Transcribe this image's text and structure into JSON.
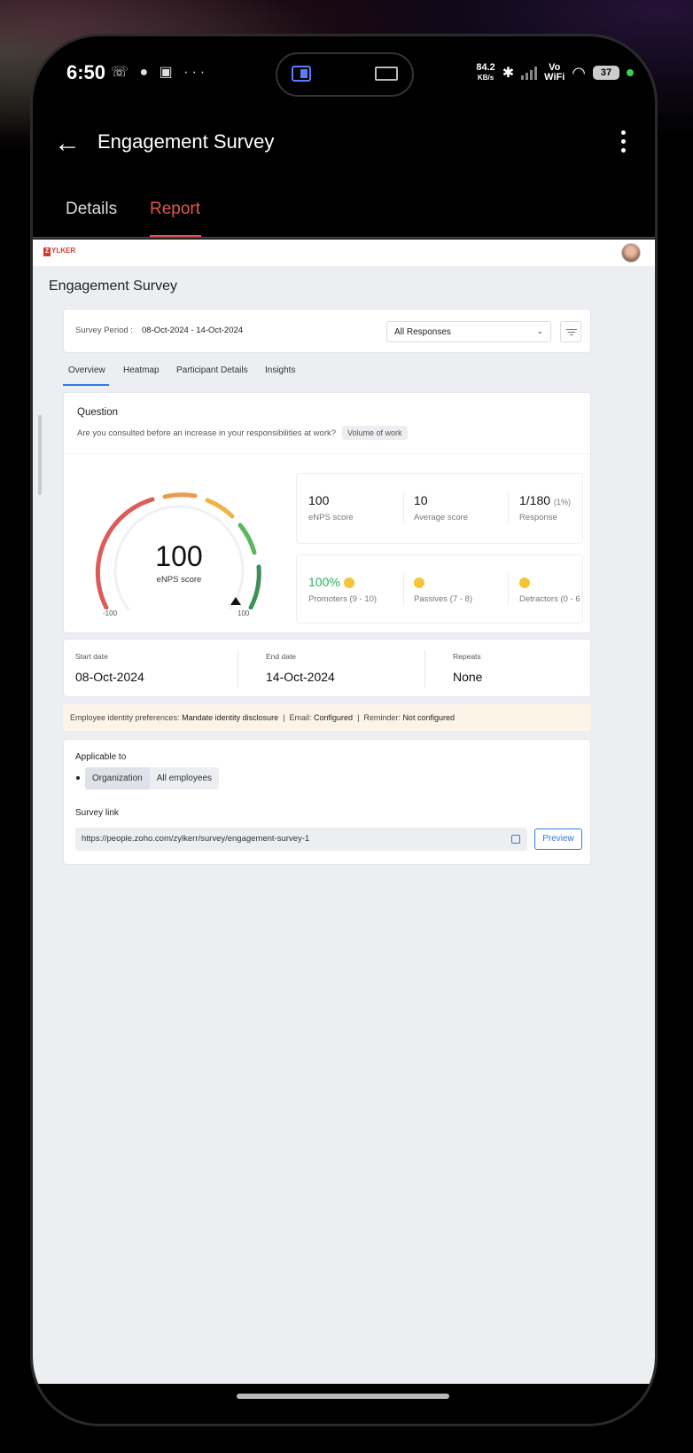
{
  "status_bar": {
    "time": "6:50",
    "left_icons": "☏ ● ▣ ···",
    "speed_value": "84.2",
    "speed_unit": "KB/s",
    "bluetooth": "✱",
    "vowifi_top": "Vo",
    "vowifi_bottom": "WiFi",
    "wifi": "◠",
    "battery": "37"
  },
  "app_bar": {
    "back_symbol": "←",
    "title": "Engagement Survey"
  },
  "tabs": {
    "details": "Details",
    "report": "Report",
    "active": "Report"
  },
  "report": {
    "logo_mark": "Z",
    "logo_text": "YLKER",
    "page_title": "Engagement Survey",
    "period_label": "Survey Period :",
    "period_value": "08-Oct-2024 - 14-Oct-2024",
    "response_filter": "All Responses",
    "sub_tabs": [
      "Overview",
      "Heatmap",
      "Participant Details",
      "Insights"
    ],
    "active_sub_tab": "Overview",
    "question_heading": "Question",
    "question_text": "Are you consulted before an increase in your responsibilities at work?",
    "question_tag": "Volume of work",
    "gauge": {
      "value": "100",
      "label": "eNPS score",
      "min": "-100",
      "max": "100",
      "level": 1.0
    },
    "stats": {
      "enps_value": "100",
      "enps_label": "eNPS score",
      "avg_value": "10",
      "avg_label": "Average score",
      "response_value": "1/180",
      "response_pct": "(1%)",
      "response_label": "Response",
      "promoters_value": "100%",
      "promoters_label": "Promoters (9 - 10)",
      "passives_label": "Passives (7 - 8)",
      "detractors_label": "Detractors (0 - 6"
    },
    "dates": {
      "start_label": "Start date",
      "start_value": "08-Oct-2024",
      "end_label": "End date",
      "end_value": "14-Oct-2024",
      "repeats_label": "Repeats",
      "repeats_value": "None"
    },
    "banner": {
      "identity_label": "Employee identity preferences:",
      "identity_value": "Mandate identity disclosure",
      "email_label": "Email:",
      "email_value": "Configured",
      "reminder_label": "Reminder:",
      "reminder_value": "Not configured"
    },
    "applicable_label": "Applicable to",
    "applicable_options": [
      "Organization",
      "All employees"
    ],
    "survey_link_label": "Survey link",
    "survey_link": "https://people.zoho.com/zylkerr/survey/engagement-survey-1",
    "preview_label": "Preview"
  },
  "colors": {
    "accent_red": "#e8554e",
    "link_blue": "#2f7ae5",
    "positive_green": "#2bb35a"
  }
}
